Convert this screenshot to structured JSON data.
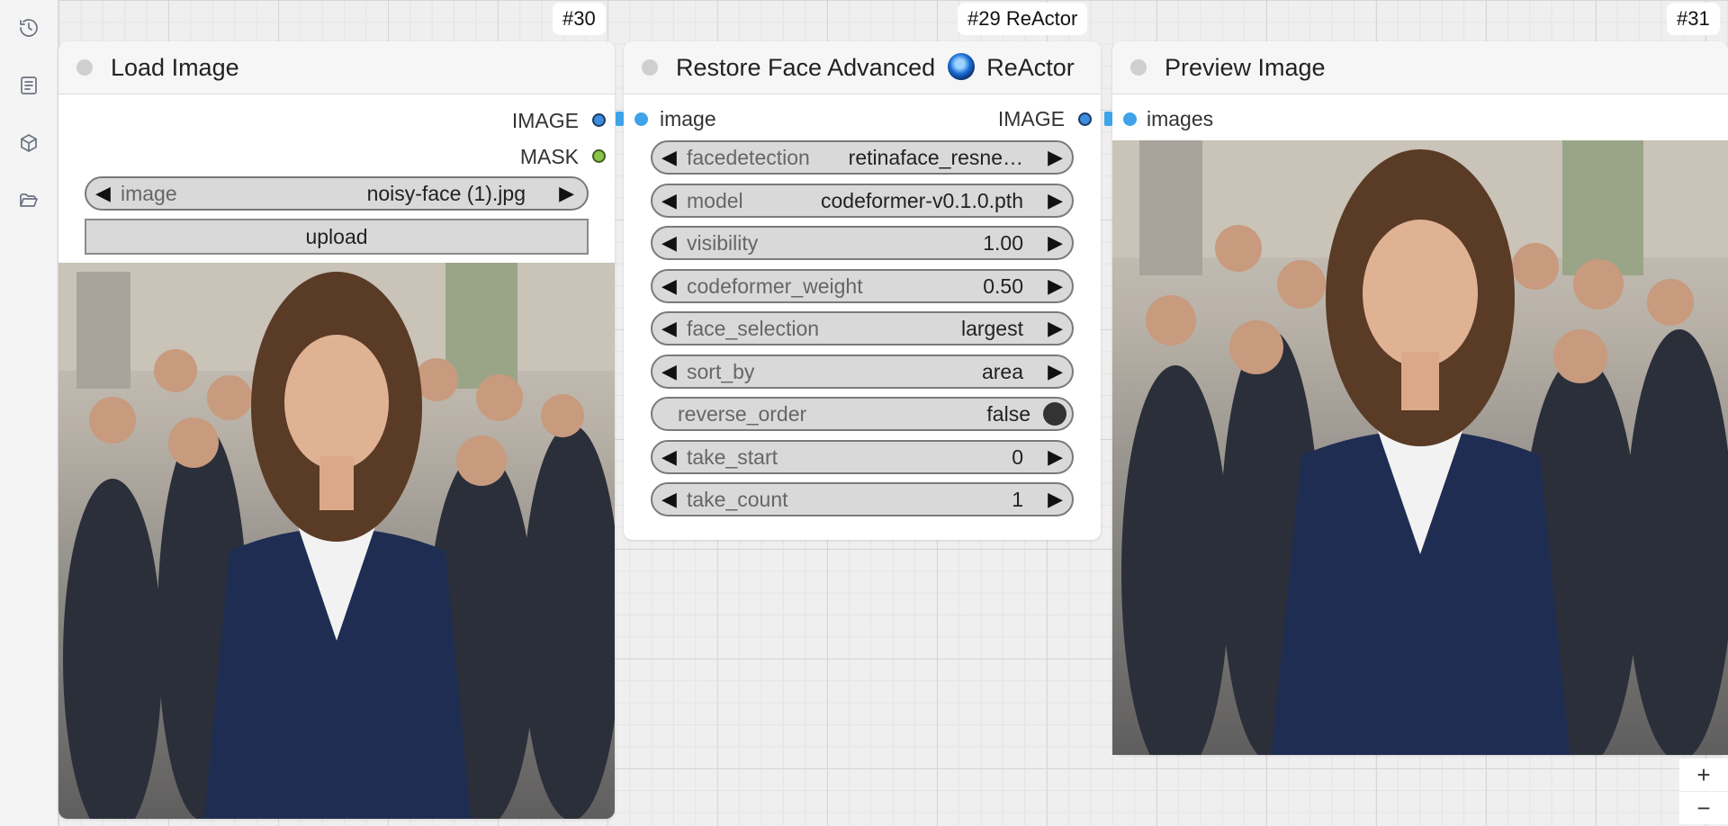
{
  "badges": {
    "load": "#30",
    "restore": "#29 ReActor",
    "preview": "#31"
  },
  "load_image": {
    "title": "Load Image",
    "outputs": [
      {
        "label": "IMAGE",
        "color": "#3a8de0"
      },
      {
        "label": "MASK",
        "color": "#8bc34a"
      }
    ],
    "image_widget": {
      "label": "image",
      "value": "noisy-face (1).jpg"
    },
    "upload_label": "upload"
  },
  "restore_face": {
    "title": "Restore Face Advanced",
    "title_suffix": "ReActor",
    "input_label": "image",
    "output_label": "IMAGE",
    "widgets": [
      {
        "label": "facedetection",
        "value": "retinaface_resne…"
      },
      {
        "label": "model",
        "value": "codeformer-v0.1.0.pth"
      },
      {
        "label": "visibility",
        "value": "1.00"
      },
      {
        "label": "codeformer_weight",
        "value": "0.50"
      },
      {
        "label": "face_selection",
        "value": "largest"
      },
      {
        "label": "sort_by",
        "value": "area"
      },
      {
        "label": "reverse_order",
        "value": "false",
        "toggle": true
      },
      {
        "label": "take_start",
        "value": "0"
      },
      {
        "label": "take_count",
        "value": "1"
      }
    ]
  },
  "preview_image": {
    "title": "Preview Image",
    "input_label": "images"
  },
  "zoom": {
    "in": "+",
    "out": "−"
  },
  "colors": {
    "link": "#3ea3e8",
    "image_slot": "#3a8de0",
    "mask_slot": "#8bc34a"
  },
  "icons": [
    "history-icon",
    "document-icon",
    "cube-icon",
    "folder-icon"
  ]
}
